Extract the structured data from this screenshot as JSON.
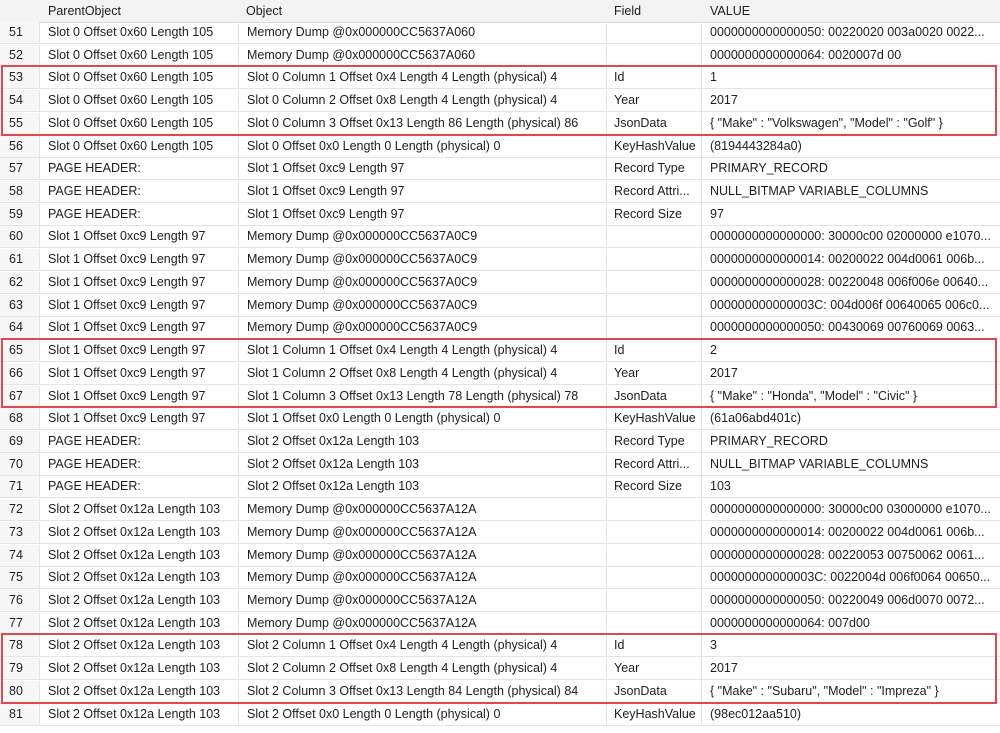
{
  "columns": {
    "parent": "ParentObject",
    "object": "Object",
    "field": "Field",
    "value": "VALUE"
  },
  "rows": [
    {
      "num": "51",
      "parent": "Slot 0 Offset 0x60 Length 105",
      "object": "Memory Dump @0x000000CC5637A060",
      "field": "",
      "value": "0000000000000050:   00220020 003a0020 0022..."
    },
    {
      "num": "52",
      "parent": "Slot 0 Offset 0x60 Length 105",
      "object": "Memory Dump @0x000000CC5637A060",
      "field": "",
      "value": "0000000000000064:   0020007d 00"
    },
    {
      "num": "53",
      "parent": "Slot 0 Offset 0x60 Length 105",
      "object": "Slot 0 Column 1 Offset 0x4 Length 4 Length (physical) 4",
      "field": "Id",
      "value": "1"
    },
    {
      "num": "54",
      "parent": "Slot 0 Offset 0x60 Length 105",
      "object": "Slot 0 Column 2 Offset 0x8 Length 4 Length (physical) 4",
      "field": "Year",
      "value": "2017"
    },
    {
      "num": "55",
      "parent": "Slot 0 Offset 0x60 Length 105",
      "object": "Slot 0 Column 3 Offset 0x13 Length 86 Length (physical) 86",
      "field": "JsonData",
      "value": "{ \"Make\" : \"Volkswagen\", \"Model\" : \"Golf\" }"
    },
    {
      "num": "56",
      "parent": "Slot 0 Offset 0x60 Length 105",
      "object": "Slot 0 Offset 0x0 Length 0 Length (physical) 0",
      "field": "KeyHashValue",
      "value": "(8194443284a0)"
    },
    {
      "num": "57",
      "parent": "PAGE HEADER:",
      "object": "Slot 1 Offset 0xc9 Length 97",
      "field": "Record Type",
      "value": "PRIMARY_RECORD"
    },
    {
      "num": "58",
      "parent": "PAGE HEADER:",
      "object": "Slot 1 Offset 0xc9 Length 97",
      "field": "Record Attri...",
      "value": " NULL_BITMAP VARIABLE_COLUMNS"
    },
    {
      "num": "59",
      "parent": "PAGE HEADER:",
      "object": "Slot 1 Offset 0xc9 Length 97",
      "field": "Record Size",
      "value": "97"
    },
    {
      "num": "60",
      "parent": "Slot 1 Offset 0xc9 Length 97",
      "object": "Memory Dump @0x000000CC5637A0C9",
      "field": "",
      "value": "0000000000000000:   30000c00 02000000 e1070..."
    },
    {
      "num": "61",
      "parent": "Slot 1 Offset 0xc9 Length 97",
      "object": "Memory Dump @0x000000CC5637A0C9",
      "field": "",
      "value": "0000000000000014:   00200022 004d0061 006b..."
    },
    {
      "num": "62",
      "parent": "Slot 1 Offset 0xc9 Length 97",
      "object": "Memory Dump @0x000000CC5637A0C9",
      "field": "",
      "value": "0000000000000028:   00220048 006f006e 00640..."
    },
    {
      "num": "63",
      "parent": "Slot 1 Offset 0xc9 Length 97",
      "object": "Memory Dump @0x000000CC5637A0C9",
      "field": "",
      "value": "000000000000003C:   004d006f 00640065 006c0..."
    },
    {
      "num": "64",
      "parent": "Slot 1 Offset 0xc9 Length 97",
      "object": "Memory Dump @0x000000CC5637A0C9",
      "field": "",
      "value": "0000000000000050:   00430069 00760069 0063..."
    },
    {
      "num": "65",
      "parent": "Slot 1 Offset 0xc9 Length 97",
      "object": "Slot 1 Column 1 Offset 0x4 Length 4 Length (physical) 4",
      "field": "Id",
      "value": "2"
    },
    {
      "num": "66",
      "parent": "Slot 1 Offset 0xc9 Length 97",
      "object": "Slot 1 Column 2 Offset 0x8 Length 4 Length (physical) 4",
      "field": "Year",
      "value": "2017"
    },
    {
      "num": "67",
      "parent": "Slot 1 Offset 0xc9 Length 97",
      "object": "Slot 1 Column 3 Offset 0x13 Length 78 Length (physical) 78",
      "field": "JsonData",
      "value": "{ \"Make\" : \"Honda\", \"Model\" : \"Civic\" }"
    },
    {
      "num": "68",
      "parent": "Slot 1 Offset 0xc9 Length 97",
      "object": "Slot 1 Offset 0x0 Length 0 Length (physical) 0",
      "field": "KeyHashValue",
      "value": "(61a06abd401c)"
    },
    {
      "num": "69",
      "parent": "PAGE HEADER:",
      "object": "Slot 2 Offset 0x12a Length 103",
      "field": "Record Type",
      "value": "PRIMARY_RECORD"
    },
    {
      "num": "70",
      "parent": "PAGE HEADER:",
      "object": "Slot 2 Offset 0x12a Length 103",
      "field": "Record Attri...",
      "value": " NULL_BITMAP VARIABLE_COLUMNS"
    },
    {
      "num": "71",
      "parent": "PAGE HEADER:",
      "object": "Slot 2 Offset 0x12a Length 103",
      "field": "Record Size",
      "value": "103"
    },
    {
      "num": "72",
      "parent": "Slot 2 Offset 0x12a Length 103",
      "object": "Memory Dump @0x000000CC5637A12A",
      "field": "",
      "value": "0000000000000000:   30000c00 03000000 e1070..."
    },
    {
      "num": "73",
      "parent": "Slot 2 Offset 0x12a Length 103",
      "object": "Memory Dump @0x000000CC5637A12A",
      "field": "",
      "value": "0000000000000014:   00200022 004d0061 006b..."
    },
    {
      "num": "74",
      "parent": "Slot 2 Offset 0x12a Length 103",
      "object": "Memory Dump @0x000000CC5637A12A",
      "field": "",
      "value": "0000000000000028:   00220053 00750062 0061..."
    },
    {
      "num": "75",
      "parent": "Slot 2 Offset 0x12a Length 103",
      "object": "Memory Dump @0x000000CC5637A12A",
      "field": "",
      "value": "000000000000003C:   0022004d 006f0064 00650..."
    },
    {
      "num": "76",
      "parent": "Slot 2 Offset 0x12a Length 103",
      "object": "Memory Dump @0x000000CC5637A12A",
      "field": "",
      "value": "0000000000000050:   00220049 006d0070 0072..."
    },
    {
      "num": "77",
      "parent": "Slot 2 Offset 0x12a Length 103",
      "object": "Memory Dump @0x000000CC5637A12A",
      "field": "",
      "value": "0000000000000064:   007d00"
    },
    {
      "num": "78",
      "parent": "Slot 2 Offset 0x12a Length 103",
      "object": "Slot 2 Column 1 Offset 0x4 Length 4 Length (physical) 4",
      "field": "Id",
      "value": "3"
    },
    {
      "num": "79",
      "parent": "Slot 2 Offset 0x12a Length 103",
      "object": "Slot 2 Column 2 Offset 0x8 Length 4 Length (physical) 4",
      "field": "Year",
      "value": "2017"
    },
    {
      "num": "80",
      "parent": "Slot 2 Offset 0x12a Length 103",
      "object": "Slot 2 Column 3 Offset 0x13 Length 84 Length (physical) 84",
      "field": "JsonData",
      "value": "{ \"Make\" : \"Subaru\", \"Model\" : \"Impreza\" }"
    },
    {
      "num": "81",
      "parent": "Slot 2 Offset 0x12a Length 103",
      "object": "Slot 2 Offset 0x0 Length 0 Length (physical) 0",
      "field": "KeyHashValue",
      "value": "(98ec012aa510)"
    }
  ],
  "highlight_color": "#e2474b",
  "highlight_groups": [
    {
      "first_row": 53,
      "last_row": 55
    },
    {
      "first_row": 65,
      "last_row": 67
    },
    {
      "first_row": 78,
      "last_row": 80
    }
  ]
}
